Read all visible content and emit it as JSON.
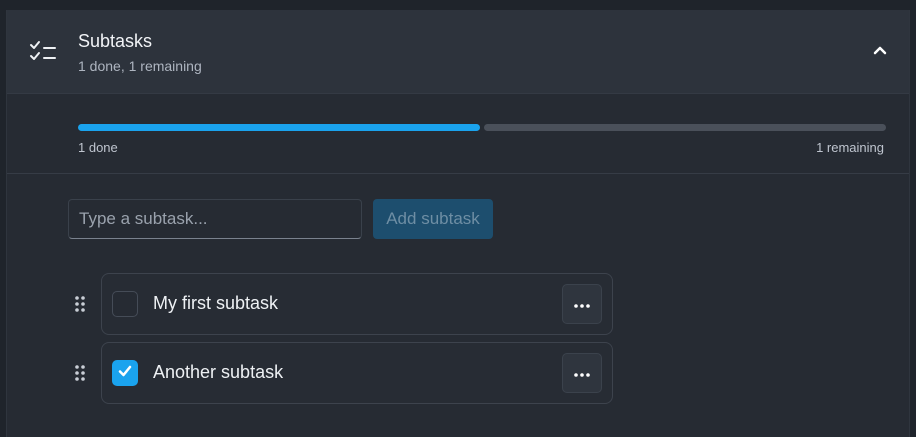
{
  "header": {
    "title": "Subtasks",
    "subtitle": "1 done, 1 remaining",
    "icon": "checklist-icon",
    "collapse_icon": "chevron-up-icon"
  },
  "progress": {
    "done_fraction": 0.5,
    "done_label": "1 done",
    "remaining_label": "1 remaining",
    "done_color": "#1aa3ee",
    "remaining_color": "#4a505a"
  },
  "add": {
    "placeholder": "Type a subtask...",
    "value": "",
    "button_label": "Add subtask"
  },
  "subtasks": [
    {
      "label": "My first subtask",
      "checked": false
    },
    {
      "label": "Another subtask",
      "checked": true
    }
  ],
  "colors": {
    "accent": "#1aa3ee"
  }
}
